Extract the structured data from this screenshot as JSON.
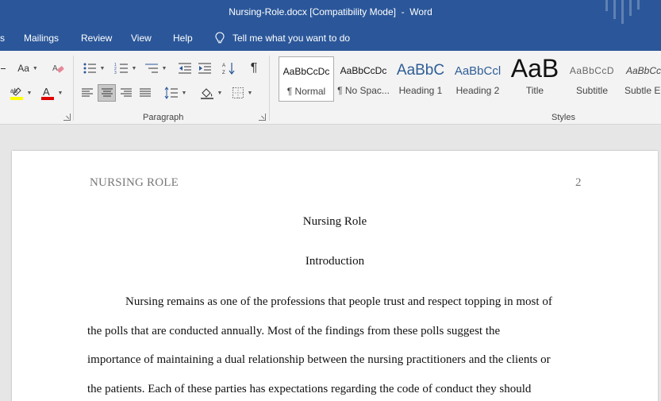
{
  "window": {
    "title": "Nursing-Role.docx [Compatibility Mode]  -  Word"
  },
  "tabs": {
    "partial": "s",
    "mailings": "Mailings",
    "review": "Review",
    "view": "View",
    "help": "Help",
    "tell_me": "Tell me what you want to do",
    "tell_me_icon": "lightbulb-icon"
  },
  "ribbon": {
    "font_group": {
      "change_case": "Aa",
      "font_color": "#e00000",
      "highlight_color": "#ffff00"
    },
    "paragraph": {
      "label": "Paragraph",
      "pilcrow": "¶",
      "active_alignment": "center"
    },
    "styles": {
      "label": "Styles",
      "items": [
        {
          "preview": "AaBbCcDc",
          "name": "¶ Normal"
        },
        {
          "preview": "AaBbCcDc",
          "name": "¶ No Spac..."
        },
        {
          "preview": "AaBbC",
          "name": "Heading 1"
        },
        {
          "preview": "AaBbCcl",
          "name": "Heading 2"
        },
        {
          "preview": "AaB",
          "name": "Title"
        },
        {
          "preview": "AaBbCcD",
          "name": "Subtitle"
        },
        {
          "preview": "AaBbCcD",
          "name": "Subtle Em"
        }
      ]
    }
  },
  "document": {
    "running_head": "NURSING ROLE",
    "page_number": "2",
    "title": "Nursing Role",
    "section_heading": "Introduction",
    "body_lines": [
      "Nursing remains as one of the professions that people trust and respect topping in most of",
      "the polls that are conducted annually. Most of the findings from these polls suggest the",
      "importance of maintaining a dual relationship between the nursing practitioners and the clients or",
      "the patients. Each of these parties has expectations regarding the code of conduct they should"
    ]
  }
}
